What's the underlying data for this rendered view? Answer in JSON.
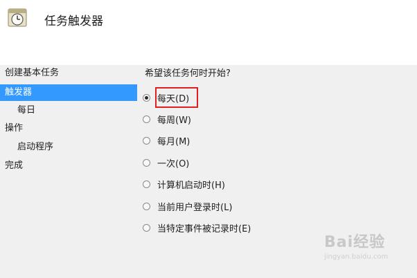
{
  "header": {
    "title": "任务触发器",
    "icon": "clock-calendar-icon"
  },
  "sidebar": {
    "items": [
      {
        "label": "创建基本任务",
        "selected": false,
        "indent": false
      },
      {
        "label": "触发器",
        "selected": true,
        "indent": false
      },
      {
        "label": "每日",
        "selected": false,
        "indent": true
      },
      {
        "label": "操作",
        "selected": false,
        "indent": false
      },
      {
        "label": "启动程序",
        "selected": false,
        "indent": true
      },
      {
        "label": "完成",
        "selected": false,
        "indent": false
      }
    ]
  },
  "main": {
    "question": "希望该任务何时开始?",
    "options": [
      {
        "label": "每天(D)",
        "checked": true
      },
      {
        "label": "每周(W)",
        "checked": false
      },
      {
        "label": "每月(M)",
        "checked": false
      },
      {
        "label": "一次(O)",
        "checked": false
      },
      {
        "label": "计算机启动时(H)",
        "checked": false
      },
      {
        "label": "当前用户登录时(L)",
        "checked": false
      },
      {
        "label": "当特定事件被记录时(E)",
        "checked": false
      }
    ]
  },
  "watermark": {
    "logo": "Bai经验",
    "url": "jingyan.baidu.com"
  },
  "colors": {
    "selection": "#3399ff",
    "annotation": "#e02020"
  }
}
